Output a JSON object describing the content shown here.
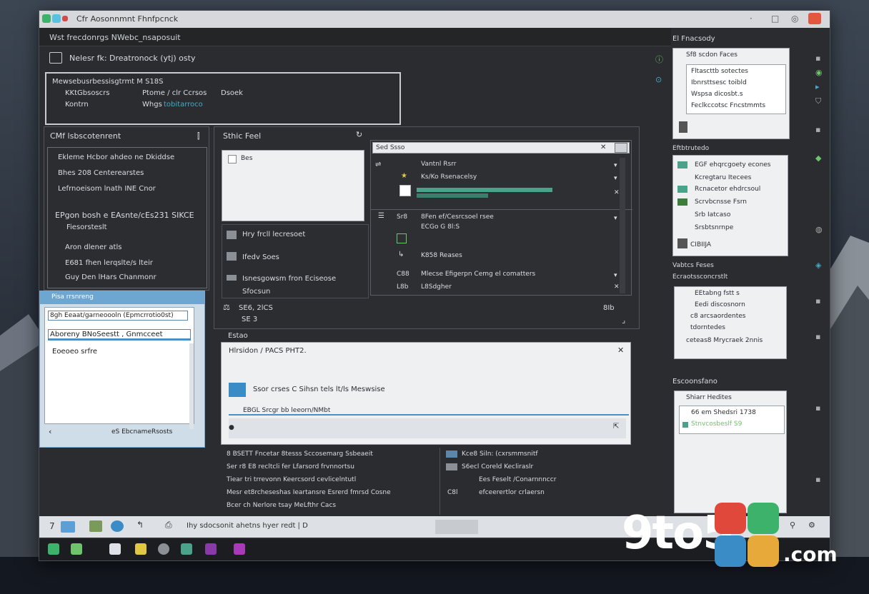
{
  "window": {
    "title": "Cfr Aosonnmnt Fhnfpcnck"
  },
  "toolbar": {
    "path_text": "Wst frecdonrgs NWebc_nsaposuit"
  },
  "info": {
    "breadcrumb": "Nelesr fk:   Dreatronock (ytj) osty",
    "line1": "Mewsebusrbessisgtrmt M S18S",
    "line2a": "KKtGbsoscrs",
    "line2b": "Ptome / clr Ccrsos",
    "line2c": "Dsoek",
    "line3a": "Kontrn",
    "line3b": "Whgs",
    "line3c": "tobitarroco"
  },
  "left_panel": {
    "title": "CMf lsbscotenrent",
    "items": [
      "Ekleme Hcbor ahdeo ne Dkiddse",
      "Bhes 208 Centerearstes",
      "Lefrnoeisom lnath INE Cnor",
      "EPgon bosh e  EAsnte/cEs231 SIKCE",
      "Fiesorsteslt",
      "Aron dlener atls",
      "E681 fhen lerqslte/s lteir",
      "Guy Den lHars Chanmonr"
    ]
  },
  "center": {
    "title": "Sthic Feel",
    "search_placeholder": "Sed Ssso",
    "preview_label": "Bes",
    "list_items": [
      "Hry frcll lecresoet",
      "Ifedv Soes",
      "Isnesgowsm fron Eciseose",
      "Sfocsun"
    ],
    "footer_count": "SE6,  2lCS",
    "footer_num": "SE 3",
    "footer_right": "8Ib"
  },
  "sub_list": {
    "items": [
      {
        "label": "Vantnl Rsrr",
        "sub": ""
      },
      {
        "label": "Ks/Ko Rsenacelsy",
        "sub": ""
      },
      {
        "label": "",
        "sub": ""
      },
      {
        "label": "8Fen ef/Cesrcsoel rsee",
        "sub": "ECGo G 8l:S"
      },
      {
        "label": "K858 Reases",
        "sub": ""
      },
      {
        "label": "Mlecse Efigerpn Cemg el comatters",
        "sub": ""
      },
      {
        "label": "L8Sdgher",
        "sub": ""
      }
    ],
    "codes": [
      "Sr8",
      "C88",
      "L8b"
    ]
  },
  "dialog": {
    "title": "Pisa rrsnreng",
    "input1": "8gh Eeaat/garneoooln (Epmcrrotio0st)",
    "input2": "Aboreny BNoSeestt ,  Gnmcceet",
    "label": "Eoeoeo srfre",
    "footer": "eS EbcnameRsosts"
  },
  "popup": {
    "header": "Estao",
    "title": "Hlrsidon / PACS PHT2.",
    "message": "Ssor crses C Sihsn tels lt/ls Meswsise",
    "progress_label": "EBGL Srcgr bb leeorn/NMbt"
  },
  "bottom_list": {
    "left": [
      "8 BSETT Fncetar 8tesss  Sccosemarg Ssbeaeit",
      "Ser r8 E8 recltcli fer Lfarsord frvnnortsu",
      "Tiear tri trrevonn Keercsord  cevlicelntutl",
      "Mesr et8rcheseshas Ieartansre Esrerd fmrsd  Cosne",
      "Bcer ch Nerlore tsay MeLfthr Cacs"
    ],
    "right": [
      "Kce8 Siln: (cxrsmmsnitf",
      "S6ecl  Coreld Kecliraslr",
      "Ees Feselt /Conarnnnccr",
      "efceerertlor crlaersn"
    ],
    "right_code": "C8l"
  },
  "status": {
    "text": "Ihy sdocsonit ahetns  hyer redt  |  D",
    "left_code": "7"
  },
  "right_panel": {
    "header1": "El Fnacsody",
    "box1_title": "Sf8 scdon Faces",
    "box1_items": [
      "Fltascttb sotectes",
      "Ibnrsttsesc toibld",
      "Wspsa dicosbt.s",
      "Feclkccotsc Fncstmmts"
    ],
    "header2": "Eftbtrutedo",
    "box2_items": [
      "EGF ehqrcgoety econes",
      "Kcregtaru Itecees",
      "Rcnacetor ehdrcsoul",
      "Scrvbcnsse Fsrn",
      "Srb Iatcaso",
      "Srsbtsnrnpe"
    ],
    "box2_footer": "CIBIIJA",
    "header3": "Vabtcs Feses",
    "header3b": "Ecraotssconcrstlt",
    "box3_items": [
      "EEtabng fstt s",
      "Eedi discosnorn",
      "c8 arcsaordentes",
      "tdorntedes",
      "ceteas8 Mrycraek 2nnis"
    ],
    "header4": "Escoonsfano",
    "box4_title": "Shiarr Hedites",
    "box4_items": [
      "66 em Shedsri 1738",
      "Stnvcosbeslf S9"
    ]
  },
  "taskbar": {
    "count": 9
  },
  "watermark": {
    "brand": "9to5",
    "suffix": ".com"
  },
  "colors": {
    "accent": "#48a8c8",
    "green": "#4aa28a",
    "bg": "#2a2c2f"
  }
}
